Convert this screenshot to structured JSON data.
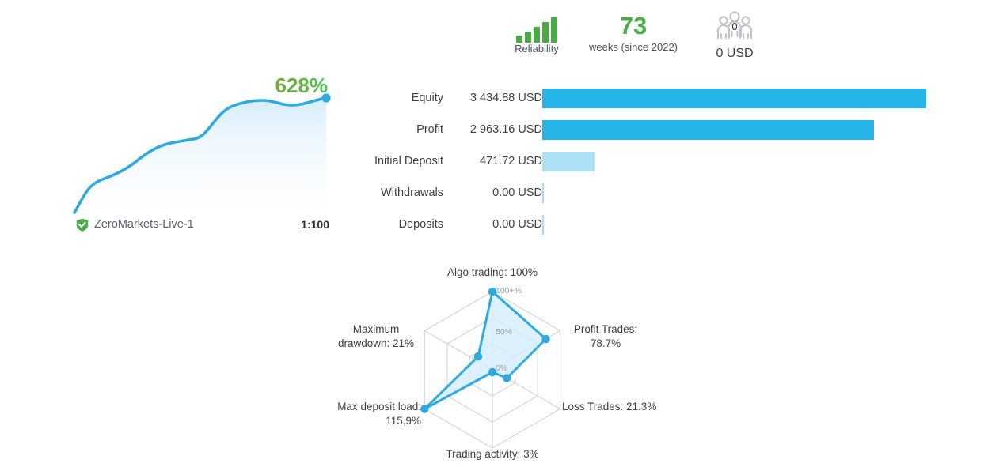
{
  "kpis": {
    "reliability": {
      "label": "Reliability",
      "icon": "signal-bars-icon",
      "bars": [
        9,
        14,
        20,
        26,
        32
      ],
      "color": "#4aa845"
    },
    "weeks": {
      "value": "73",
      "label": "weeks (since 2022)",
      "color": "#43b045"
    },
    "subscribers": {
      "icon": "people-group-icon",
      "count": "0",
      "value": "0 USD"
    }
  },
  "growth": {
    "percent": "628%",
    "percent_color": "#55b84a",
    "broker": "ZeroMarkets-Live-1",
    "broker_verified_icon": "verified-shield-icon",
    "leverage": "1:100",
    "line_color": "#2eaae0"
  },
  "stats": {
    "rows": [
      {
        "label": "Equity",
        "value": "3 434.88 USD",
        "bar_pct": 100.0,
        "bar_style": "full"
      },
      {
        "label": "Profit",
        "value": "2 963.16 USD",
        "bar_pct": 86.3,
        "bar_style": "full"
      },
      {
        "label": "Initial Deposit",
        "value": "471.72 USD",
        "bar_pct": 13.7,
        "bar_style": "light"
      },
      {
        "label": "Withdrawals",
        "value": "0.00 USD",
        "bar_pct": 0,
        "bar_style": "zero"
      },
      {
        "label": "Deposits",
        "value": "0.00 USD",
        "bar_pct": 0,
        "bar_style": "zero"
      }
    ]
  },
  "chart_data": {
    "type": "radar",
    "title": "",
    "rings": [
      "0%",
      "50%",
      "100+%"
    ],
    "axes": [
      {
        "label": "Algo trading: 100%",
        "name": "algo-trading",
        "value": 100,
        "plot": 1.0
      },
      {
        "label": "Profit Trades:\n78.7%",
        "name": "profit-trades",
        "value": 78.7,
        "plot": 0.787
      },
      {
        "label": "Loss Trades: 21.3%",
        "name": "loss-trades",
        "value": 21.3,
        "plot": 0.213
      },
      {
        "label": "Trading activity: 3%",
        "name": "trading-activity",
        "value": 3,
        "plot": 0.03
      },
      {
        "label": "Max deposit load:\n115.9%",
        "name": "max-deposit-load",
        "value": 115.9,
        "plot": 1.0
      },
      {
        "label": "Maximum\ndrawdown: 21%",
        "name": "maximum-drawdown",
        "value": 21,
        "plot": 0.21
      }
    ],
    "fill_color": "#d6eefb",
    "line_color": "#2eaae0",
    "grid_color": "#cfd4d9"
  }
}
